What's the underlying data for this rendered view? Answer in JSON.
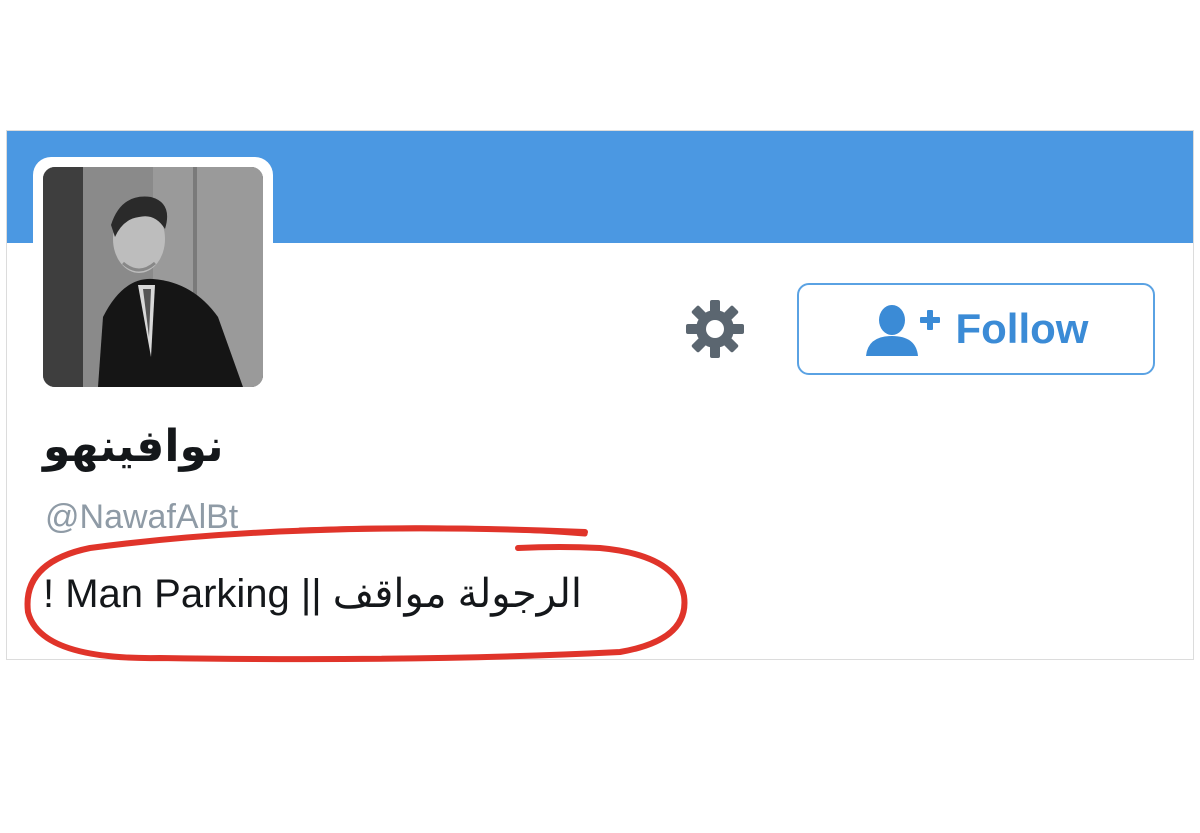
{
  "profile": {
    "display_name": "نوافينهو",
    "handle": "@NawafAlBt",
    "bio": "الرجولة مواقف || Man Parking !"
  },
  "actions": {
    "follow_label": "Follow",
    "follow_icon": "add-user-icon",
    "settings_icon": "gear-icon"
  },
  "colors": {
    "banner": "#4b98e2",
    "follow_accent": "#3b8bd6",
    "annotation": "#e0342a"
  }
}
